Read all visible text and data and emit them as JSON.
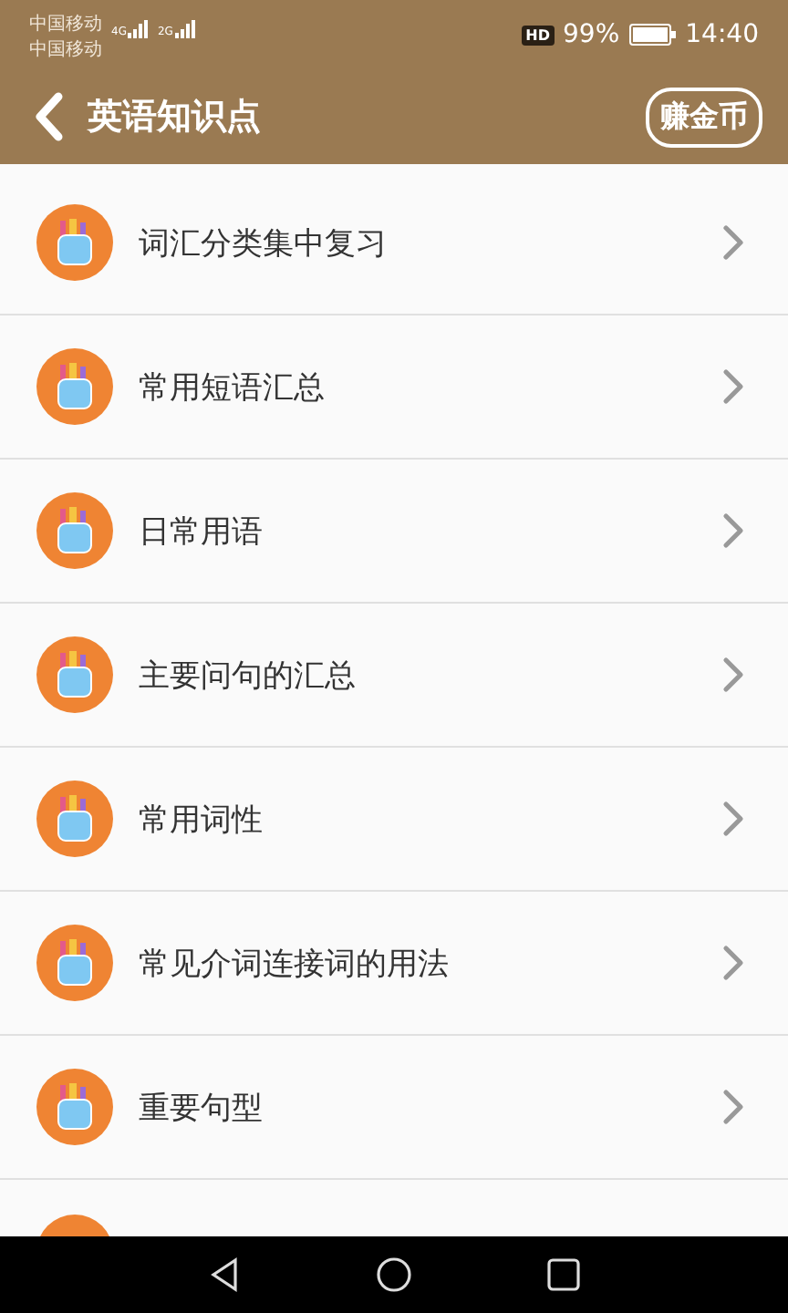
{
  "status_bar": {
    "carriers": [
      {
        "name": "中国移动",
        "network": "4G"
      },
      {
        "name": "中国移动",
        "network": "2G"
      }
    ],
    "hd": "HD",
    "battery": "99%",
    "time": "14:40"
  },
  "header": {
    "title": "英语知识点",
    "action": "赚金币"
  },
  "items": [
    {
      "label": "词汇分类集中复习"
    },
    {
      "label": "常用短语汇总"
    },
    {
      "label": "日常用语"
    },
    {
      "label": "主要问句的汇总"
    },
    {
      "label": "常用词性"
    },
    {
      "label": "常见介词连接词的用法"
    },
    {
      "label": "重要句型"
    }
  ]
}
